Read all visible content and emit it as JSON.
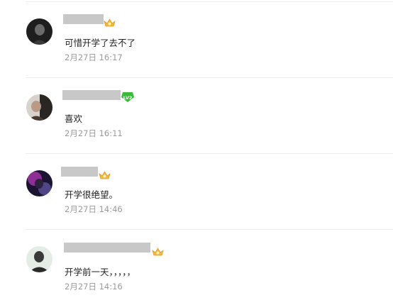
{
  "comments": [
    {
      "text": "可惜开学了去不了",
      "time": "2月27日 16:17",
      "badge": "crown-badge-icon"
    },
    {
      "text": "喜欢",
      "time": "2月27日 16:11",
      "badge": "level-badge-icon",
      "badge_label": "LV2"
    },
    {
      "text": "开学很绝望。",
      "time": "2月27日 14:46",
      "badge": "crown-badge-icon"
    },
    {
      "text": "开学前一天，，，，，",
      "time": "2月27日 14:16",
      "badge": "crown-badge-icon"
    }
  ],
  "colors": {
    "text": "#222222",
    "time": "#9a9a9a",
    "divider": "#ededed",
    "badge_gold": "#f5b83d",
    "badge_green": "#3cb83a"
  }
}
